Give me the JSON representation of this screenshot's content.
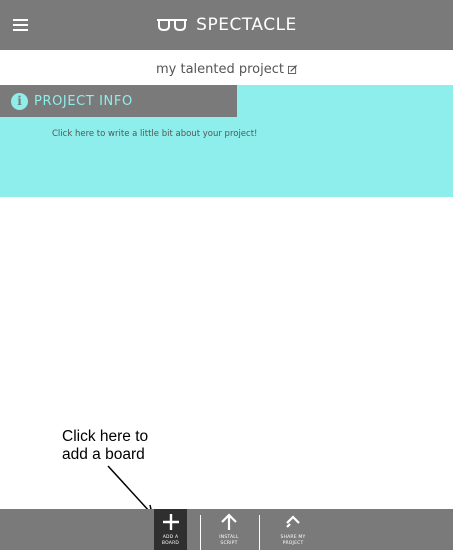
{
  "header": {
    "brand_name": "SPECTACLE",
    "colors": {
      "background": "#7a7a7a",
      "text": "#ffffff"
    }
  },
  "project": {
    "title": "my talented project"
  },
  "info_panel": {
    "title": "PROJECT INFO",
    "description": "Click here to write a little bit about your project!",
    "colors": {
      "panel": "#8eeeec",
      "tab": "#7a7a7a"
    }
  },
  "annotation": {
    "line1": "Click here to",
    "line2": "add a board"
  },
  "toolbar": {
    "buttons": [
      {
        "icon": "plus-icon",
        "label": "ADD A\nBOARD",
        "active": true
      },
      {
        "icon": "arrow-up-icon",
        "label": "INSTALL\nSCRIPT",
        "active": false
      },
      {
        "icon": "share-icon",
        "label": "SHARE MY\nPROJECT",
        "active": false
      }
    ],
    "colors": {
      "background": "#7a7a7a",
      "active": "#2f2f2f"
    }
  }
}
